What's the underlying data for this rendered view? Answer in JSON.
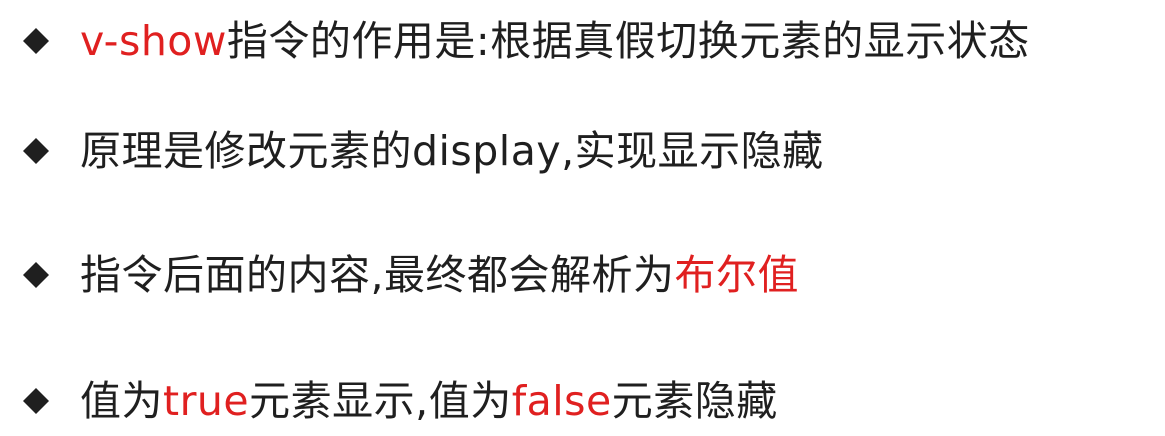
{
  "slide": {
    "accent_color": "#e02020",
    "text_color": "#1f1f1f",
    "bullets": [
      {
        "icon": "diamond-bullet-icon",
        "segments": [
          {
            "text": "v-show",
            "highlight": true
          },
          {
            "text": "指令的作用是:根据真假切换元素的显示状态",
            "highlight": false
          }
        ]
      },
      {
        "icon": "diamond-bullet-icon",
        "segments": [
          {
            "text": "原理是修改元素的display,实现显示隐藏",
            "highlight": false
          }
        ]
      },
      {
        "icon": "diamond-bullet-icon",
        "segments": [
          {
            "text": "指令后面的内容,最终都会解析为",
            "highlight": false
          },
          {
            "text": "布尔值",
            "highlight": true
          }
        ]
      },
      {
        "icon": "diamond-bullet-icon",
        "segments": [
          {
            "text": "值为",
            "highlight": false
          },
          {
            "text": "true",
            "highlight": true
          },
          {
            "text": "元素显示,值为",
            "highlight": false
          },
          {
            "text": "false",
            "highlight": true
          },
          {
            "text": "元素隐藏",
            "highlight": false
          }
        ]
      }
    ]
  }
}
